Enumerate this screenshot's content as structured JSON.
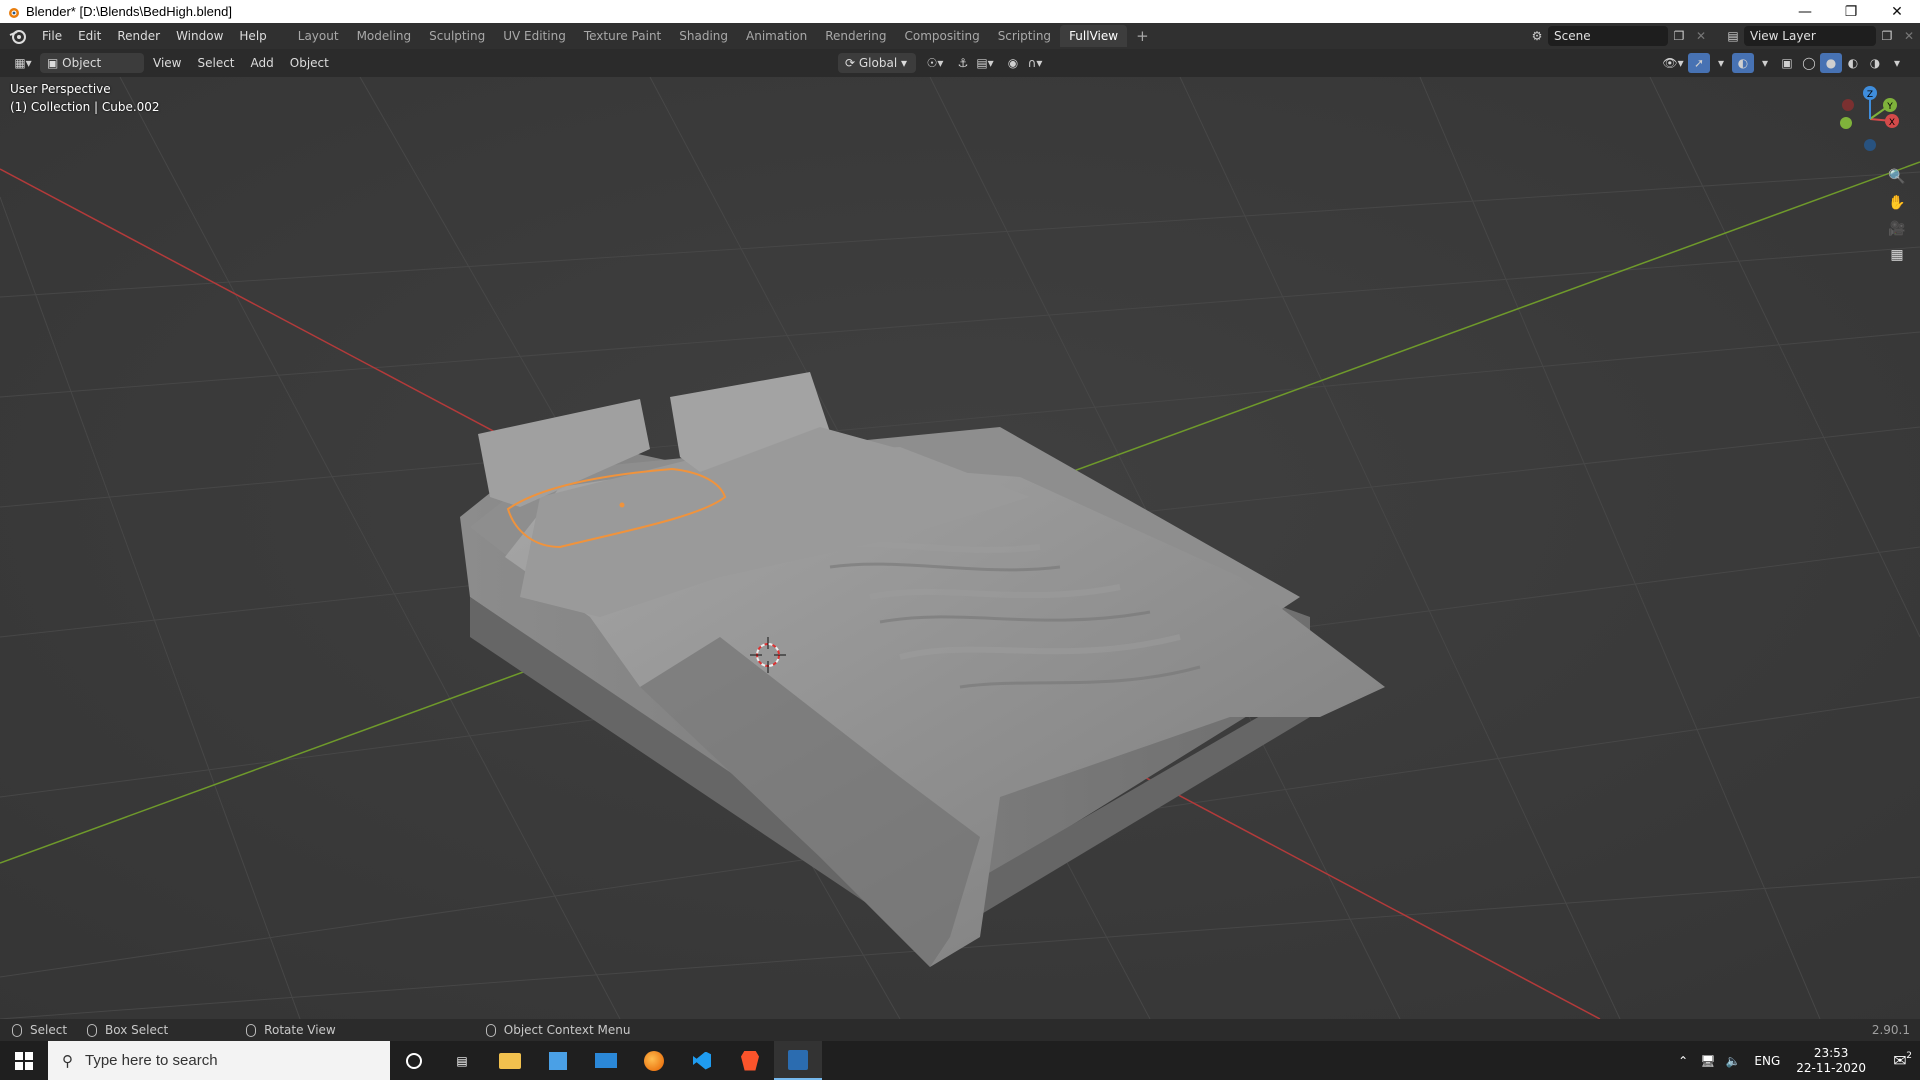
{
  "window": {
    "title": "Blender* [D:\\Blends\\BedHigh.blend]",
    "controls": [
      "minimize",
      "restore",
      "close"
    ]
  },
  "menu": [
    "File",
    "Edit",
    "Render",
    "Window",
    "Help"
  ],
  "workspaces": {
    "tabs": [
      "Layout",
      "Modeling",
      "Sculpting",
      "UV Editing",
      "Texture Paint",
      "Shading",
      "Animation",
      "Rendering",
      "Compositing",
      "Scripting",
      "FullView"
    ],
    "active": "FullView",
    "add_label": "+"
  },
  "scene": {
    "name": "Scene",
    "view_layer": "View Layer"
  },
  "viewport_header": {
    "mode": "Object Mode",
    "menus": [
      "View",
      "Select",
      "Add",
      "Object"
    ],
    "transform_orientation": "Global"
  },
  "viewport": {
    "perspective_label": "User Perspective",
    "collection_label": "(1) Collection | Cube.002",
    "gizmo_axes": [
      "X",
      "Y",
      "Z"
    ]
  },
  "statusbar": {
    "items": [
      "Select",
      "Box Select",
      "Rotate View",
      "Object Context Menu"
    ],
    "version": "2.90.1"
  },
  "taskbar": {
    "search_placeholder": "Type here to search",
    "language": "ENG",
    "time": "23:53",
    "date": "22-11-2020",
    "notification_count": "2"
  },
  "colors": {
    "grid_bg": "#3a3a3a",
    "x_axis": "#b33a3a",
    "y_axis": "#6f9a2b",
    "selection_outline": "#f0933c",
    "taskbar_accent": "#76b9ed"
  }
}
